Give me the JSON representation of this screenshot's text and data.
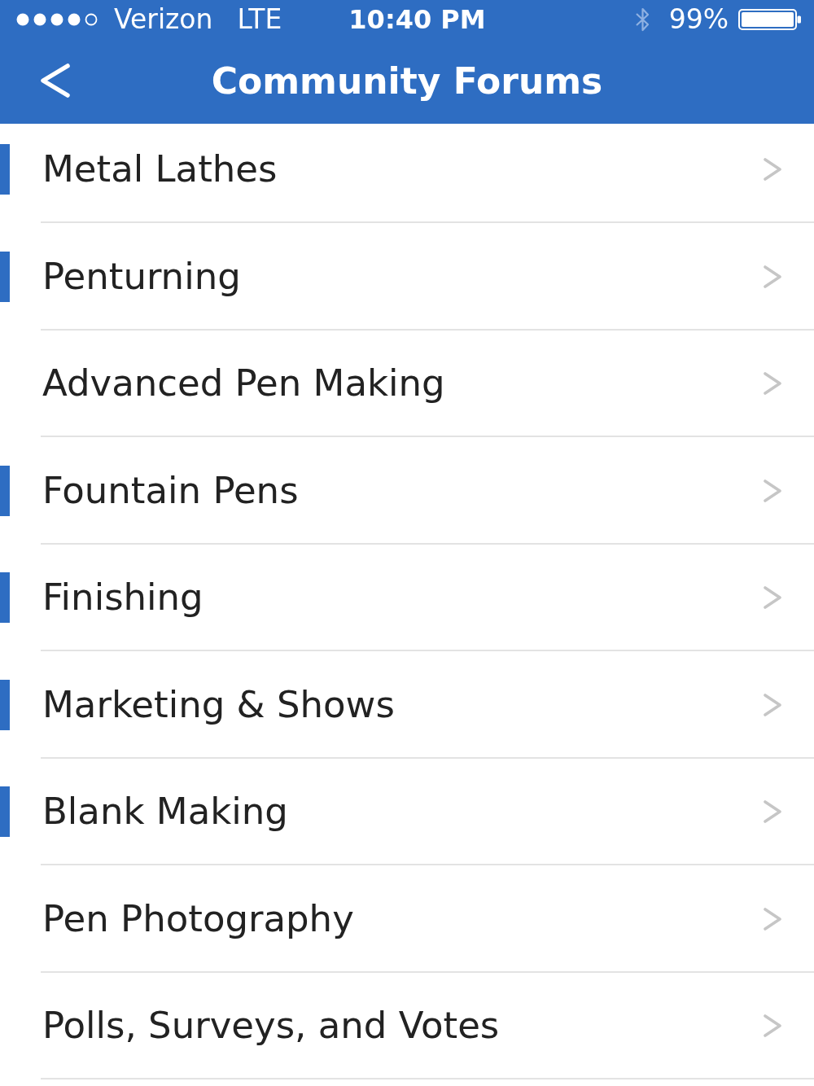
{
  "status_bar": {
    "carrier": "Verizon",
    "network": "LTE",
    "time": "10:40 PM",
    "battery": "99%"
  },
  "nav_bar": {
    "title": "Community Forums"
  },
  "forums": [
    {
      "name": "Metal Lathes",
      "unread": true
    },
    {
      "name": "Penturning",
      "unread": true
    },
    {
      "name": "Advanced Pen Making",
      "unread": false
    },
    {
      "name": "Fountain Pens",
      "unread": true
    },
    {
      "name": "Finishing",
      "unread": true
    },
    {
      "name": "Marketing & Shows",
      "unread": true
    },
    {
      "name": "Blank Making",
      "unread": true
    },
    {
      "name": "Pen Photography",
      "unread": false
    },
    {
      "name": "Polls, Surveys, and Votes",
      "unread": false
    }
  ]
}
